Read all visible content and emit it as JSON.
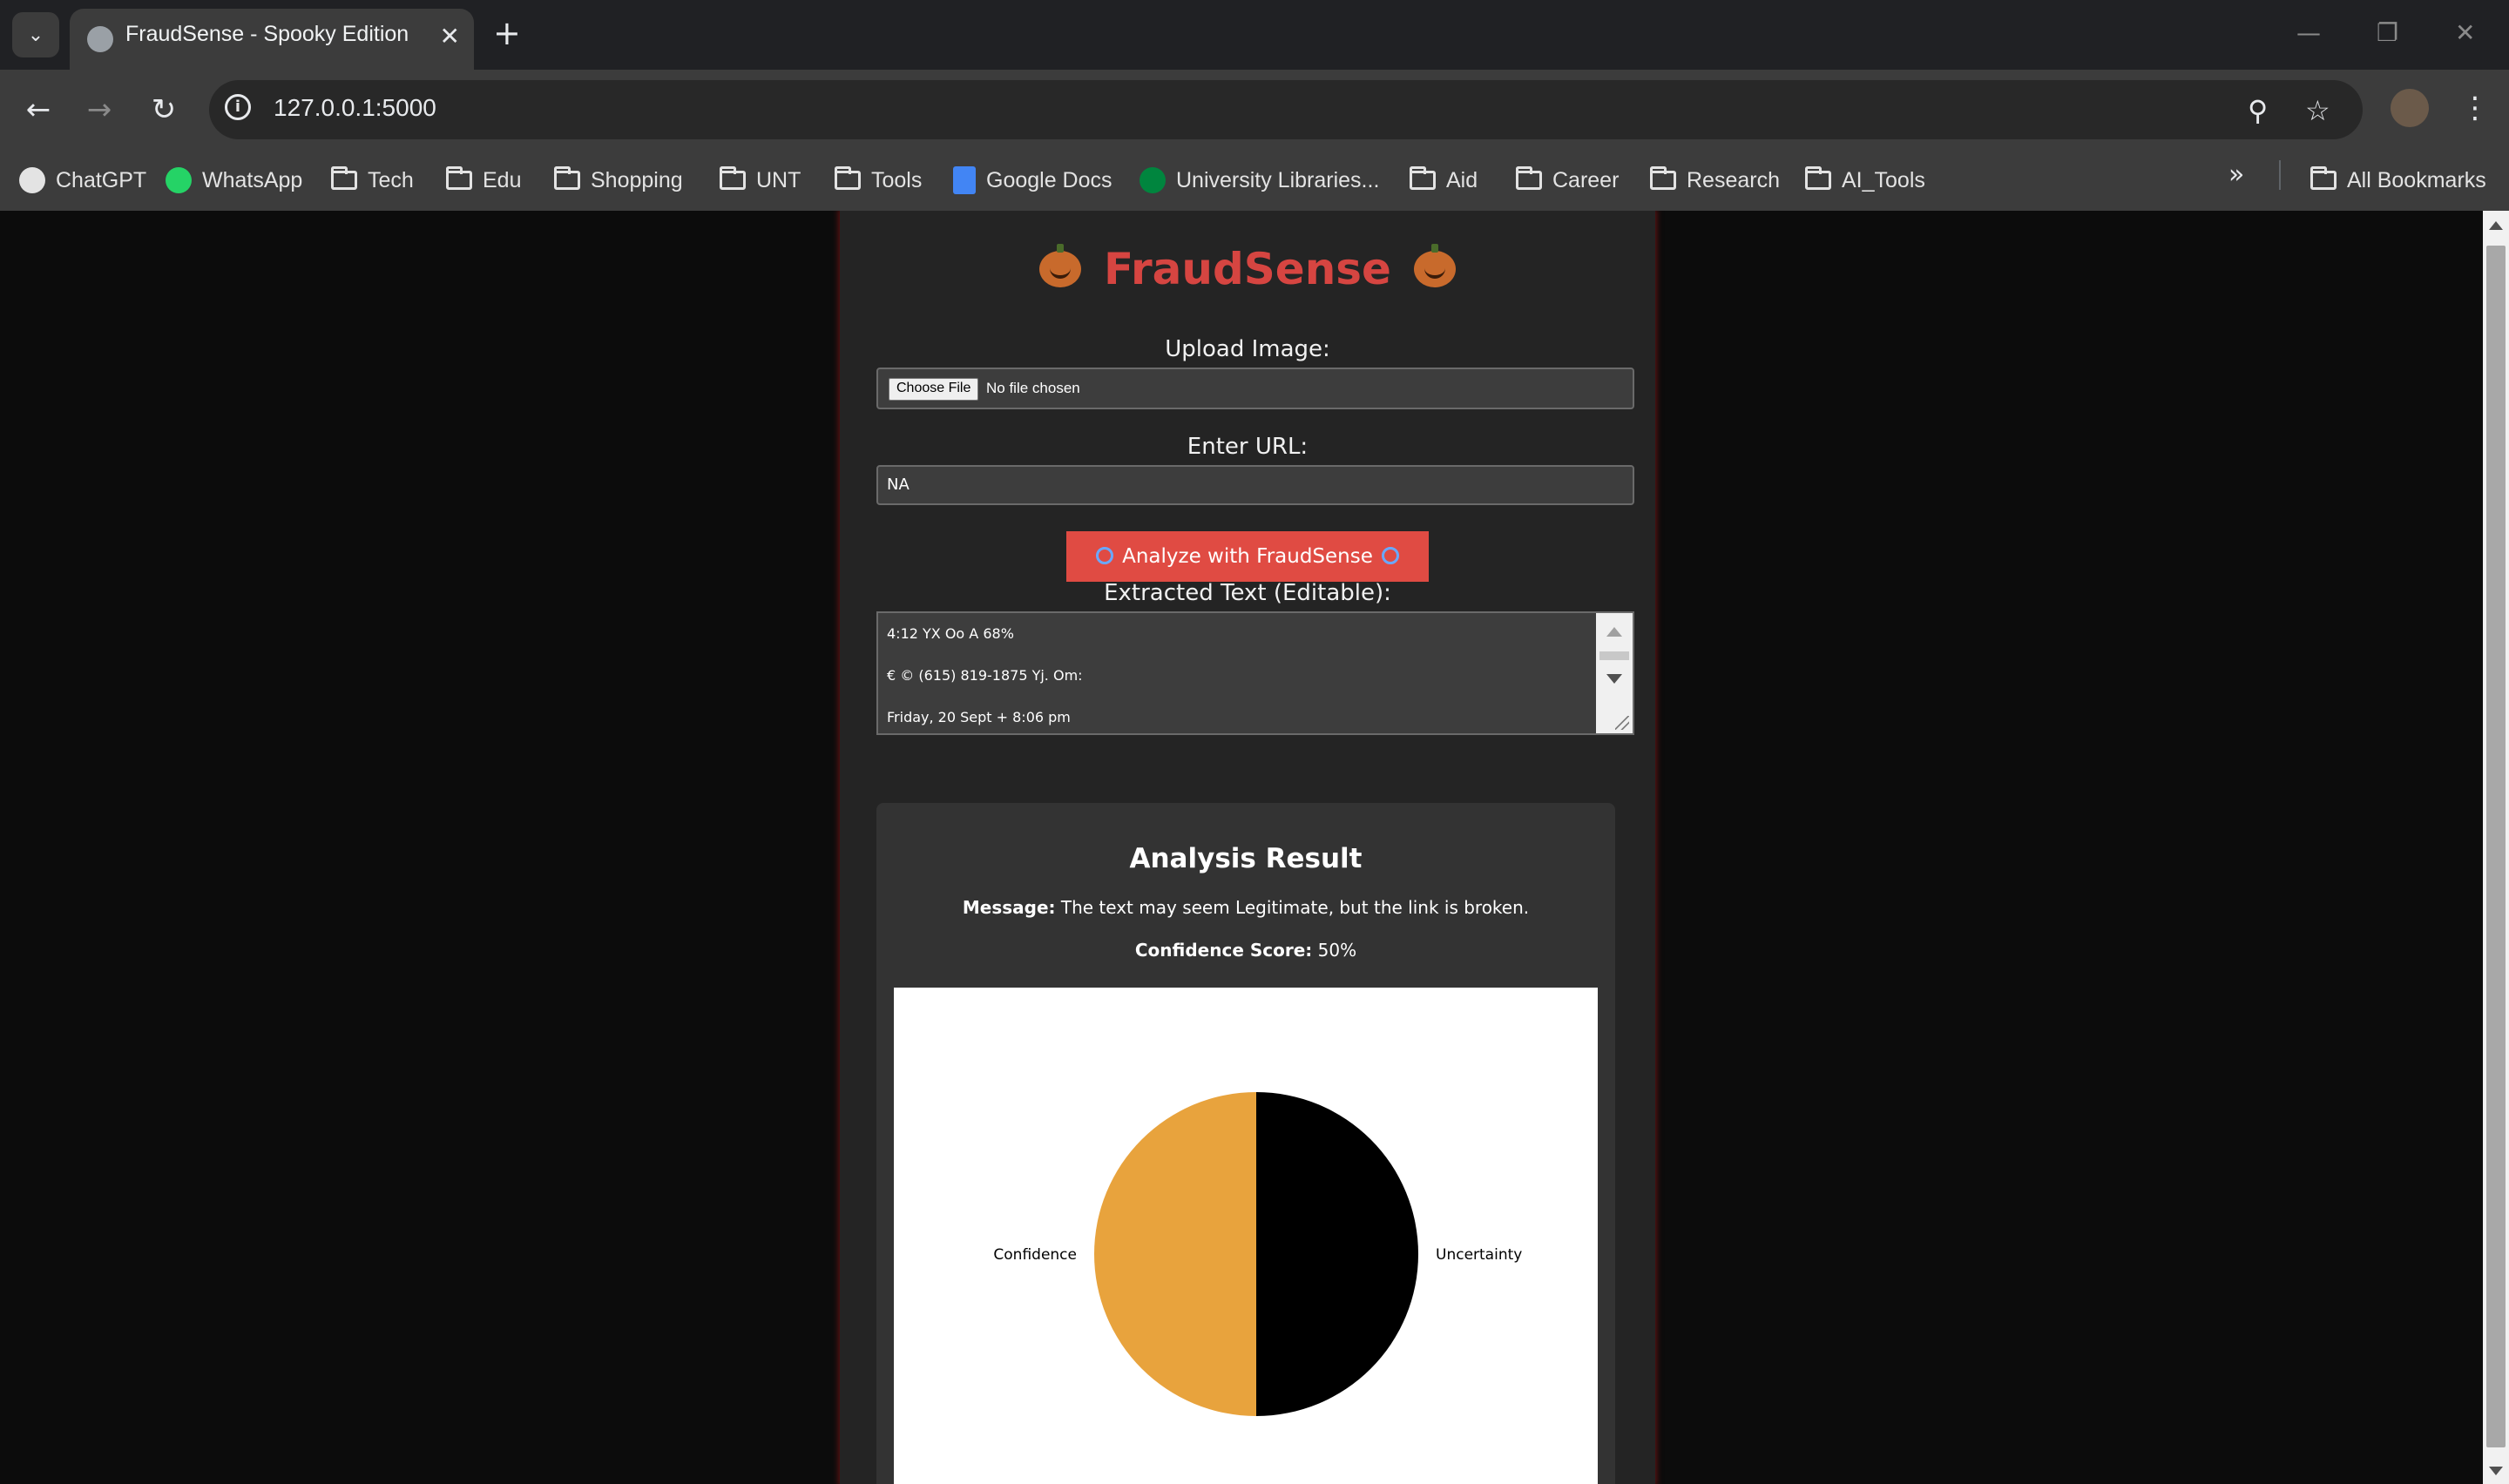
{
  "browser": {
    "tab_title": "FraudSense - Spooky Edition",
    "url": "127.0.0.1:5000",
    "bookmarks": [
      {
        "label": "ChatGPT",
        "icon": "chatgpt-icon"
      },
      {
        "label": "WhatsApp",
        "icon": "whatsapp-icon"
      },
      {
        "label": "Tech",
        "icon": "folder-icon"
      },
      {
        "label": "Edu",
        "icon": "folder-icon"
      },
      {
        "label": "Shopping",
        "icon": "folder-icon"
      },
      {
        "label": "UNT",
        "icon": "folder-icon"
      },
      {
        "label": "Tools",
        "icon": "folder-icon"
      },
      {
        "label": "Google Docs",
        "icon": "google-docs-icon"
      },
      {
        "label": "University Libraries...",
        "icon": "unt-icon"
      },
      {
        "label": "Aid",
        "icon": "folder-icon"
      },
      {
        "label": "Career",
        "icon": "folder-icon"
      },
      {
        "label": "Research",
        "icon": "folder-icon"
      },
      {
        "label": "AI_Tools",
        "icon": "folder-icon"
      }
    ],
    "all_bookmarks_label": "All Bookmarks"
  },
  "page": {
    "title": "FraudSense",
    "upload_label": "Upload Image:",
    "choose_file_label": "Choose File",
    "file_status": "No file chosen",
    "url_label": "Enter URL:",
    "url_value": "NA",
    "analyze_label": "Analyze with FraudSense",
    "extracted_label": "Extracted Text (Editable):",
    "extracted_lines": [
      "4:12 YX Oo A 68%",
      "€ © (615) 819-1875 Yj. Om:",
      "Friday, 20 Sept + 8:06 pm"
    ]
  },
  "result": {
    "title": "Analysis Result",
    "message_label": "Message:",
    "message_text": "The text may seem Legitimate, but the link is broken.",
    "confidence_label": "Confidence Score:",
    "confidence_text": "50%"
  },
  "chart_data": {
    "type": "pie",
    "categories": [
      "Confidence",
      "Uncertainty"
    ],
    "values": [
      50,
      50
    ],
    "colors": [
      "#E8A33D",
      "#000000"
    ]
  }
}
